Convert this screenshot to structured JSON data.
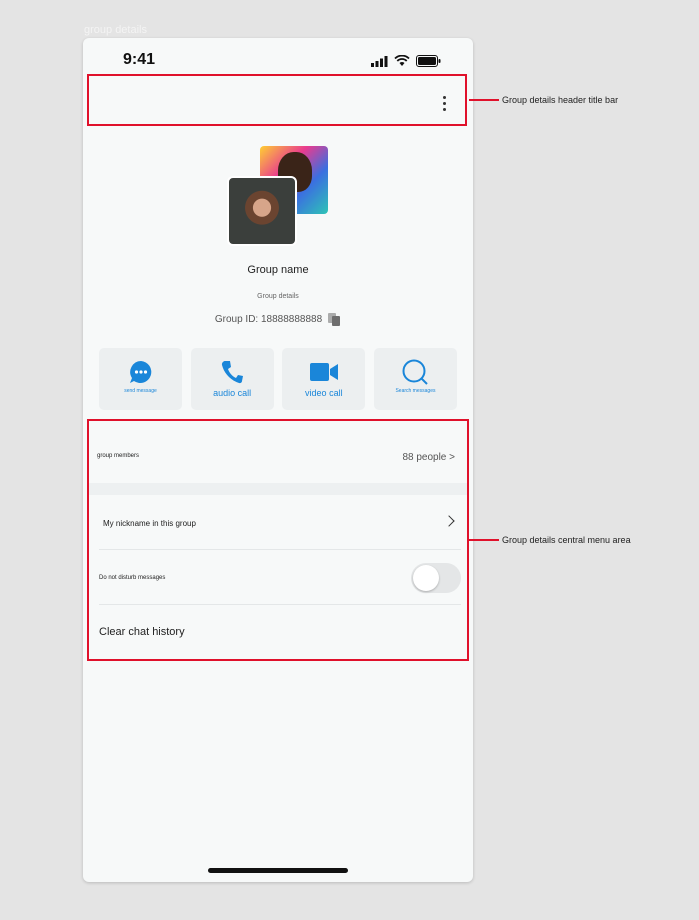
{
  "canvas": {
    "label": "group details"
  },
  "status_bar": {
    "time": "9:41"
  },
  "header": {
    "more_icon": "more-vertical-icon"
  },
  "group": {
    "name": "Group name",
    "details": "Group details",
    "id_text": "Group ID: 18888888888"
  },
  "actions": [
    {
      "label": "send message",
      "icon": "chat-bubble-icon"
    },
    {
      "label": "audio call",
      "icon": "phone-icon"
    },
    {
      "label": "video call",
      "icon": "video-camera-icon"
    },
    {
      "label": "Search messages",
      "icon": "search-icon"
    }
  ],
  "menu": {
    "members_label": "group members",
    "members_value": "88 people >",
    "nickname_label": "My nickname in this group",
    "dnd_label": "Do not disturb messages",
    "dnd_enabled": false,
    "clear_label": "Clear chat history"
  },
  "annotations": {
    "header": "Group details header title bar",
    "menu": "Group details central menu area"
  },
  "colors": {
    "accent": "#1a86d9",
    "annotation": "#e0112b"
  }
}
